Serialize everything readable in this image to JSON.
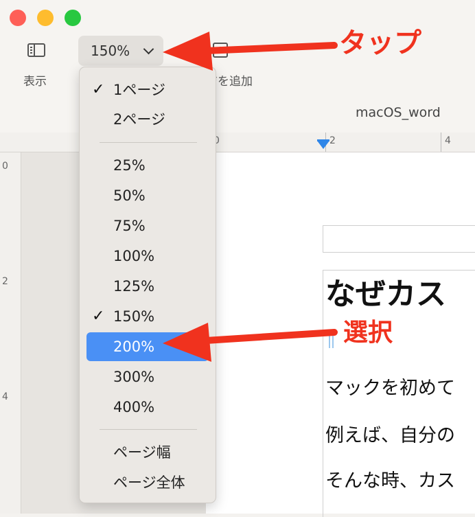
{
  "window": {
    "title": "macOS_word"
  },
  "toolbar": {
    "view_label": "表示",
    "zoom_value": "150%",
    "add_page_label": "ジを追加"
  },
  "ruler": {
    "horizontal": [
      "0",
      "2",
      "4"
    ],
    "vertical": [
      "0",
      "2",
      "4"
    ]
  },
  "document": {
    "heading": "なぜカス",
    "paragraphs": [
      "マックを初めて",
      "例えば、自分の",
      "そんな時、カス"
    ]
  },
  "zoom_menu": {
    "page_items": [
      {
        "label": "1ページ",
        "checked": true
      },
      {
        "label": "2ページ",
        "checked": false
      }
    ],
    "zoom_items": [
      {
        "label": "25%",
        "checked": false
      },
      {
        "label": "50%",
        "checked": false
      },
      {
        "label": "75%",
        "checked": false
      },
      {
        "label": "100%",
        "checked": false
      },
      {
        "label": "125%",
        "checked": false
      },
      {
        "label": "150%",
        "checked": true
      },
      {
        "label": "200%",
        "checked": false,
        "highlighted": true
      },
      {
        "label": "300%",
        "checked": false
      },
      {
        "label": "400%",
        "checked": false
      }
    ],
    "fit_items": [
      {
        "label": "ページ幅"
      },
      {
        "label": "ページ全体"
      }
    ],
    "check_mark": "✓"
  },
  "annotations": {
    "tap": "タップ",
    "select": "選択",
    "color": "#f0321e"
  },
  "colors": {
    "highlight": "#4a90f5",
    "traffic_red": "#fe5f57",
    "traffic_yellow": "#febc2e",
    "traffic_green": "#28c840"
  }
}
